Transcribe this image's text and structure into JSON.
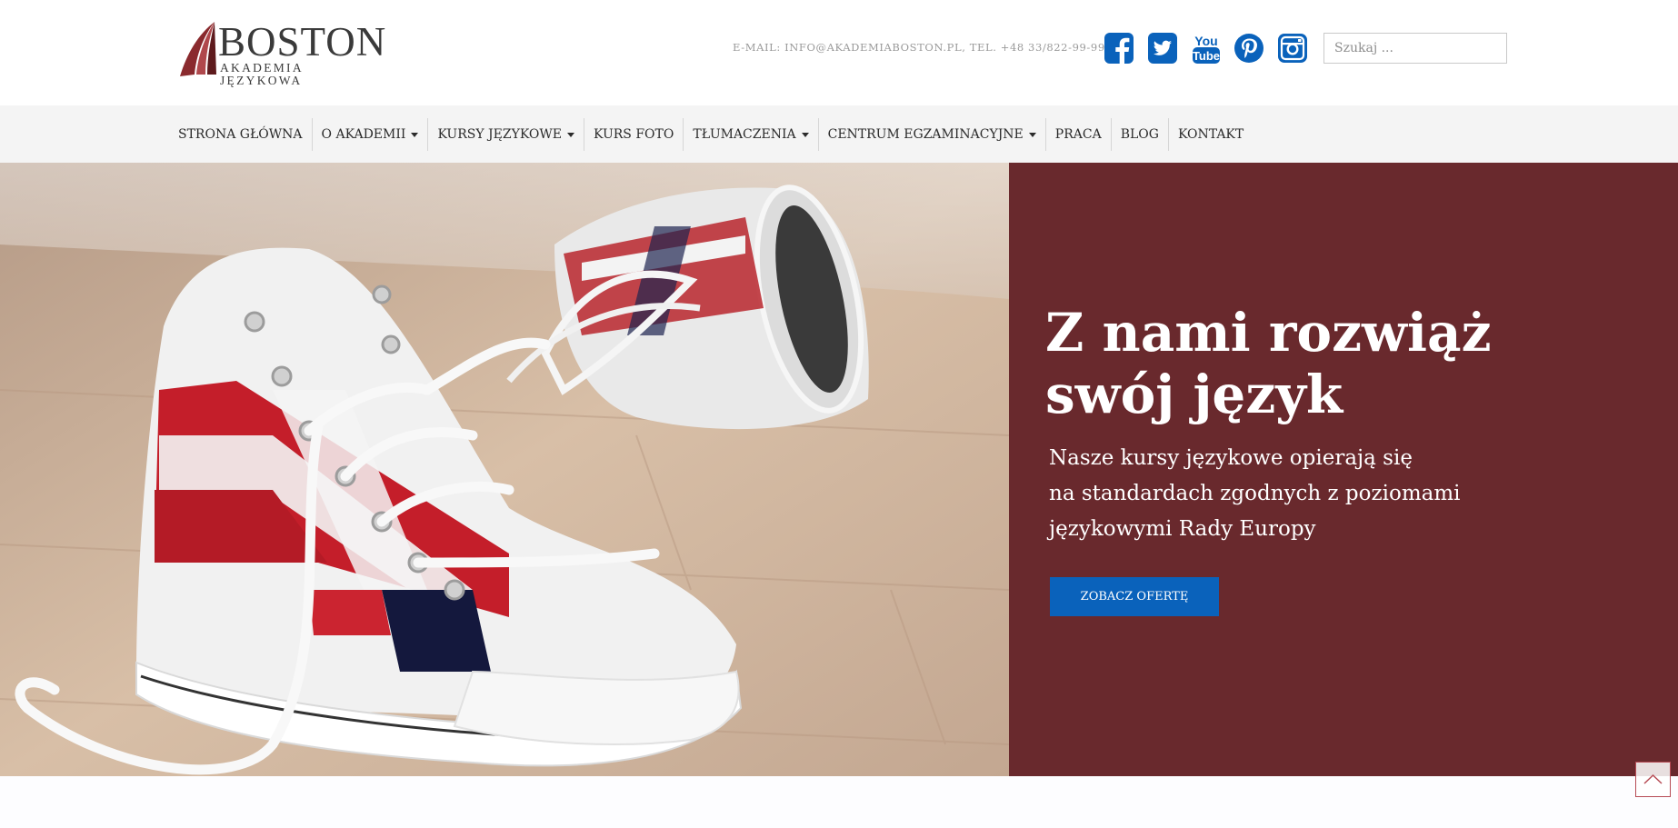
{
  "logo": {
    "name": "BOSTON",
    "subtitle": "AKADEMIA JĘZYKOWA"
  },
  "header": {
    "contact": "E-MAIL: INFO@AKADEMIABOSTON.PL, TEL. +48 33/822-99-99"
  },
  "social": [
    {
      "icon": "facebook-icon"
    },
    {
      "icon": "twitter-icon"
    },
    {
      "icon": "youtube-icon",
      "label_top": "You",
      "label_bottom": "Tube"
    },
    {
      "icon": "pinterest-icon"
    },
    {
      "icon": "instagram-icon"
    }
  ],
  "search": {
    "placeholder": "Szukaj ..."
  },
  "nav": {
    "items": [
      {
        "label": "STRONA GŁÓWNA",
        "dropdown": false
      },
      {
        "label": "O AKADEMII",
        "dropdown": true
      },
      {
        "label": "KURSY JĘZYKOWE",
        "dropdown": true
      },
      {
        "label": "KURS FOTO",
        "dropdown": false
      },
      {
        "label": "TŁUMACZENIA",
        "dropdown": true
      },
      {
        "label": "CENTRUM EGZAMINACYJNE",
        "dropdown": true
      },
      {
        "label": "PRACA",
        "dropdown": false
      },
      {
        "label": "BLOG",
        "dropdown": false
      },
      {
        "label": "KONTAKT",
        "dropdown": false
      }
    ]
  },
  "hero": {
    "title_line1": "Z nami rozwiąż",
    "title_line2": "swój język",
    "text_line1": "Nasze kursy językowe opierają się",
    "text_line2": "na standardach zgodnych z poziomami",
    "text_line3": "językowymi Rady Europy",
    "button": "ZOBACZ OFERTĘ"
  },
  "colors": {
    "brand_blue": "#0a62bb",
    "panel": "#69292d",
    "nav_bg": "#f4f4f4",
    "logo_sail": "#8a2a2e"
  }
}
